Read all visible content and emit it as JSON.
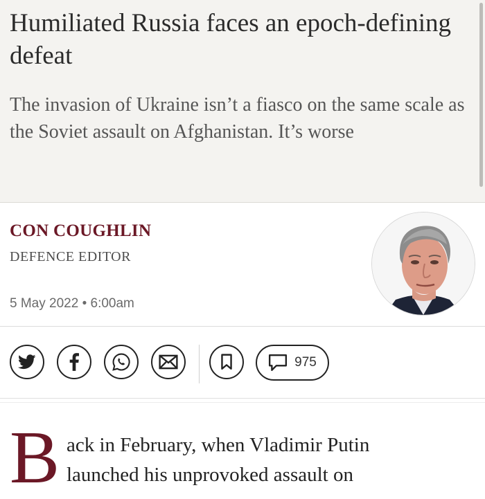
{
  "article": {
    "headline": "Humiliated Russia faces an epoch-defining defeat",
    "standfirst": "The invasion of Ukraine isn’t a fiasco on the same scale as the Soviet assault on Afghanistan. It’s worse",
    "author": {
      "name": "CON COUGHLIN",
      "role": "DEFENCE EDITOR",
      "avatar": "author-photo"
    },
    "date": "5 May 2022 • 6:00am",
    "body": {
      "drop_cap": "B",
      "line_1": "ack in February, when Vladimir Putin",
      "line_2": "launched his unprovoked assault on"
    }
  },
  "actions": {
    "share": [
      {
        "icon": "twitter-icon"
      },
      {
        "icon": "facebook-icon"
      },
      {
        "icon": "whatsapp-icon"
      },
      {
        "icon": "email-icon"
      }
    ],
    "bookmark_icon": "bookmark-icon",
    "comments": {
      "icon": "comment-icon",
      "count": "975"
    }
  },
  "colors": {
    "header_background": "#f4f3f0",
    "accent": "#6b1826",
    "text": "#222222"
  }
}
